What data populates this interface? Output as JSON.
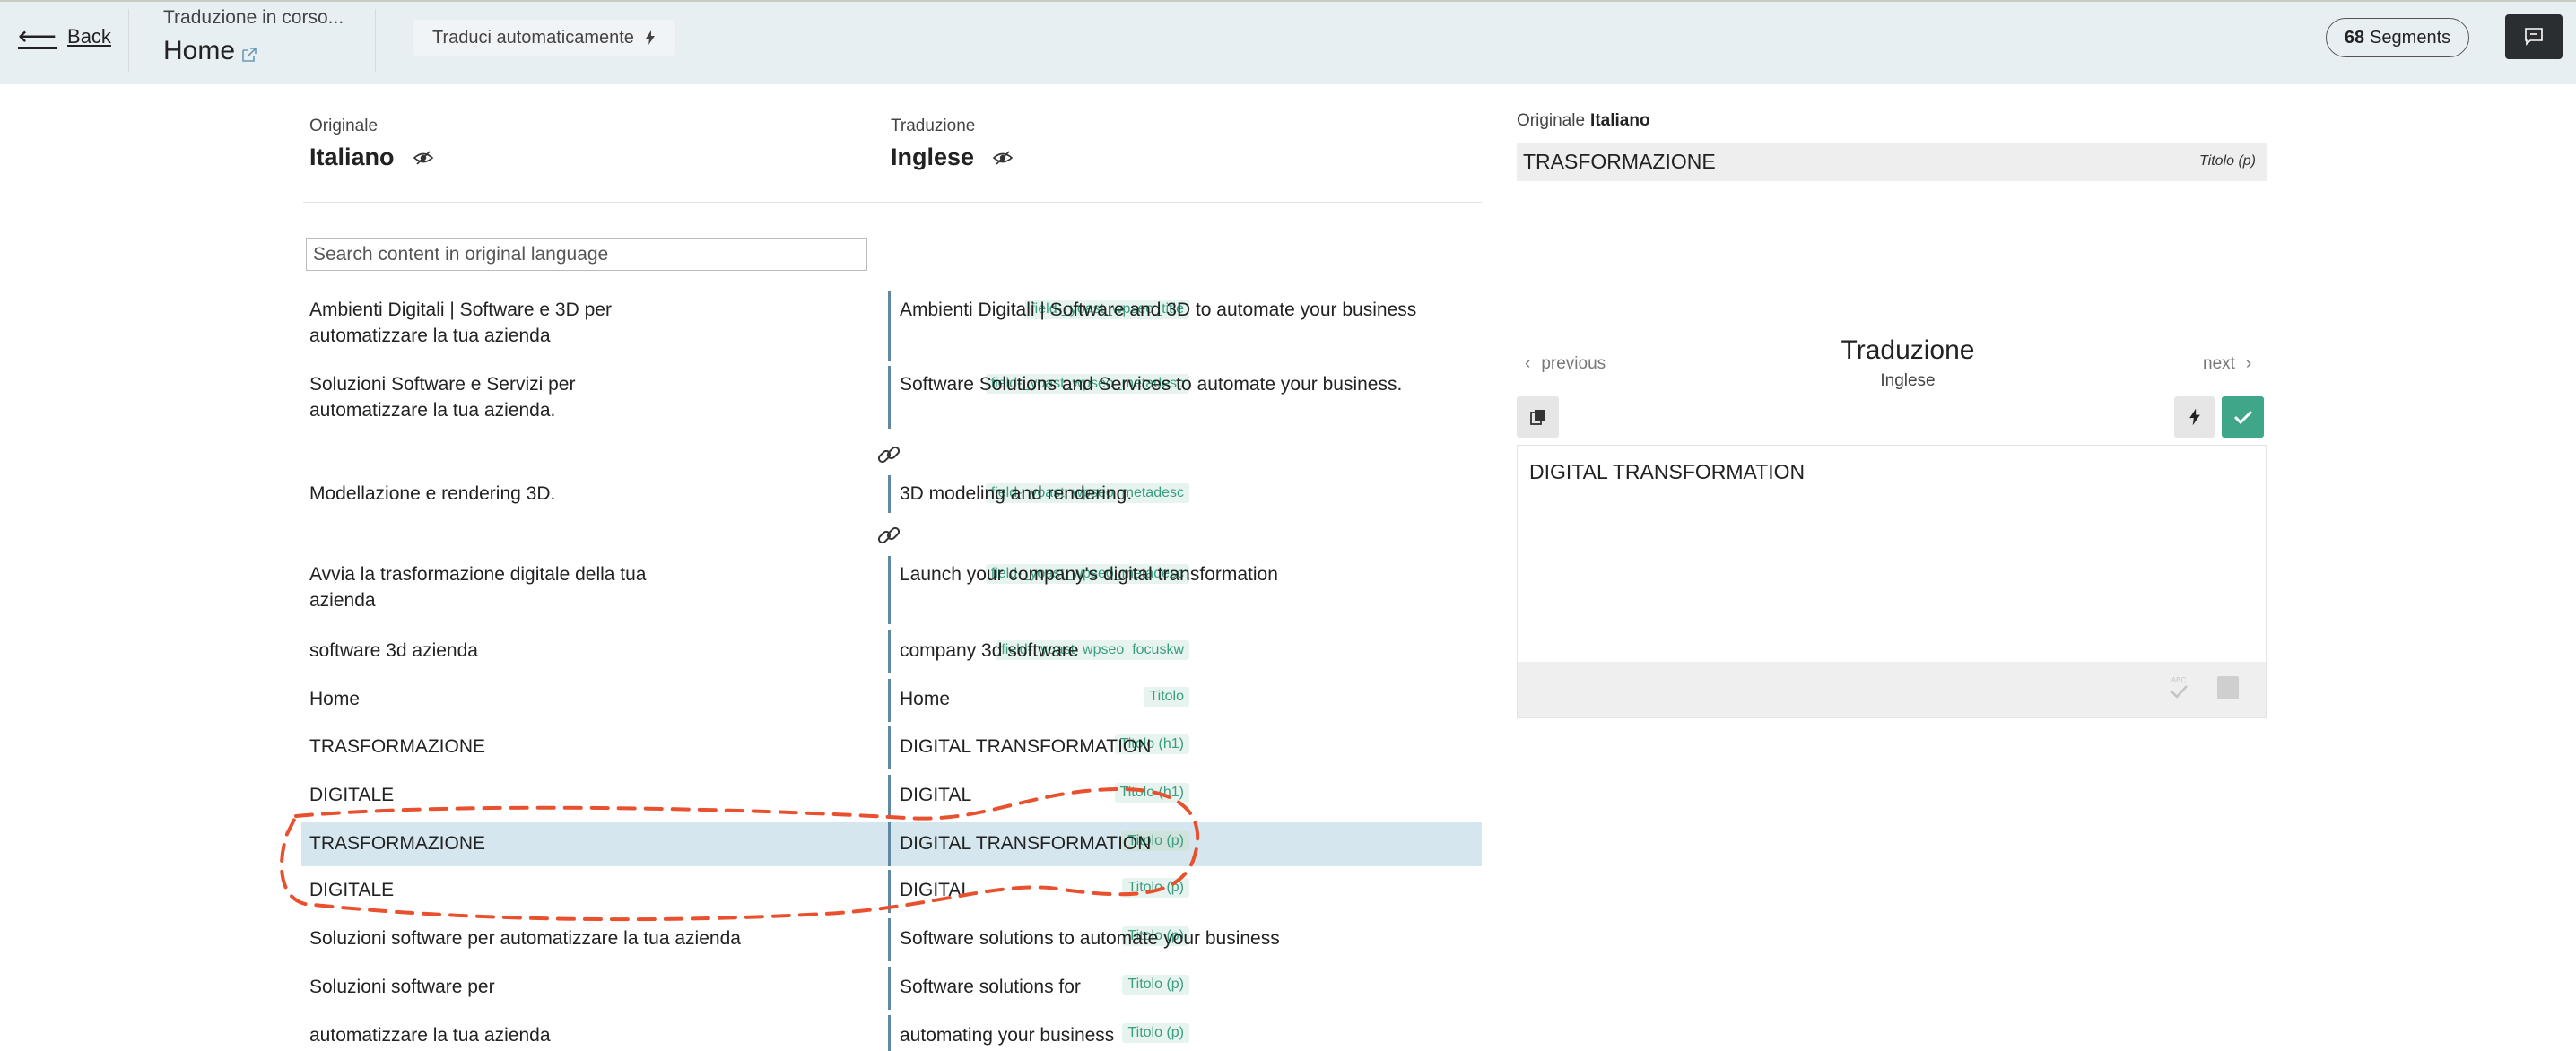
{
  "header": {
    "back_label": "Back",
    "status": "Traduzione in corso...",
    "page_title": "Home",
    "auto_translate_label": "Traduci automaticamente",
    "segments_count": "68",
    "segments_label": "Segments"
  },
  "columns": {
    "original_label": "Originale",
    "original_lang": "Italiano",
    "translation_label": "Traduzione",
    "translation_lang": "Inglese"
  },
  "search": {
    "placeholder": "Search content in original language"
  },
  "rows": [
    {
      "source": "Ambienti Digitali | Software e 3D per automatizzare la tua azienda",
      "tag": "field-_yoast_wpseo_title",
      "target": "Ambienti Digitali | Software and 3D to automate your business"
    },
    {
      "source": "Soluzioni Software e Servizi per automatizzare la tua azienda.",
      "tag": "field-_yoast_wpseo_metadesc",
      "target": "Software Solutions and Services to automate your business."
    },
    {
      "source": "Modellazione e rendering 3D.",
      "tag": "field-_yoast_wpseo_metadesc",
      "target": "3D modeling and rendering."
    },
    {
      "source": "Avvia la trasformazione digitale della tua azienda",
      "tag": "field-_yoast_wpseo_metadesc",
      "target": "Launch your company's digital transformation"
    },
    {
      "source": "software 3d azienda",
      "tag": "field-_yoast_wpseo_focuskw",
      "target": "company 3d software"
    },
    {
      "source": "Home",
      "tag": "Titolo",
      "target": "Home"
    },
    {
      "source": "TRASFORMAZIONE",
      "tag": "Titolo (h1)",
      "target": "DIGITAL TRANSFORMATION"
    },
    {
      "source": "DIGITALE",
      "tag": "Titolo (h1)",
      "target": "DIGITAL"
    },
    {
      "source": "TRASFORMAZIONE",
      "tag": "Titolo (p)",
      "target": "DIGITAL TRANSFORMATION",
      "selected": true
    },
    {
      "source": "DIGITALE",
      "tag": "Titolo (p)",
      "target": "DIGITAL"
    },
    {
      "source": "Soluzioni software per automatizzare la tua azienda",
      "tag": "Titolo (p)",
      "target": "Software solutions to automate your business"
    },
    {
      "source": "Soluzioni software per",
      "tag": "Titolo (p)",
      "target": "Software solutions for"
    },
    {
      "source": "automatizzare la tua azienda",
      "tag": "Titolo (p)",
      "target": "automating your business"
    }
  ],
  "editor_panel": {
    "original_label": "Originale",
    "original_lang": "Italiano",
    "original_text": "TRASFORMAZIONE",
    "original_tag": "Titolo (p)",
    "previous_label": "previous",
    "next_label": "next",
    "title": "Traduzione",
    "lang": "Inglese",
    "translation_text": "DIGITAL TRANSFORMATION",
    "spellcheck_label": "ABC"
  },
  "colors": {
    "accent": "#3fa68a",
    "selected_row": "#d5e6ef",
    "annotation": "#e8502e"
  }
}
